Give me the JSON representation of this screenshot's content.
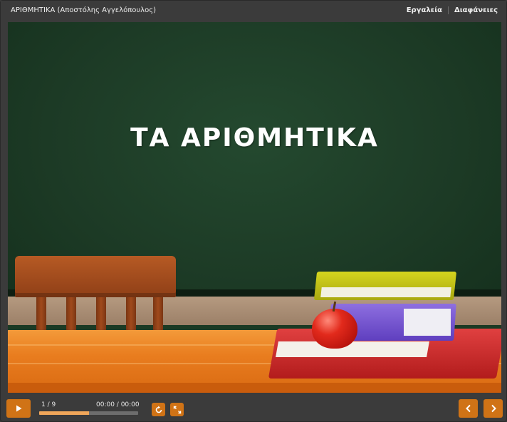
{
  "header": {
    "title": "ΑΡΙΘΜΗΤΙΚΑ (Αποστόλης Αγγελόπουλος)",
    "links": [
      "Εργαλεία",
      "Διαφάνειες"
    ]
  },
  "slide": {
    "title": "ΤΑ ΑΡΙΘΜΗΤΙΚΑ"
  },
  "player": {
    "slide_counter": "1 / 9",
    "time": "00:00 / 00:00",
    "progress": 0.5,
    "accent_color": "#d07316",
    "progress_color": "#f0a65a",
    "icons": {
      "play": "play-icon",
      "replay": "replay-icon",
      "fullscreen": "fullscreen-icon",
      "prev": "chevron-left-icon",
      "next": "chevron-right-icon"
    }
  }
}
